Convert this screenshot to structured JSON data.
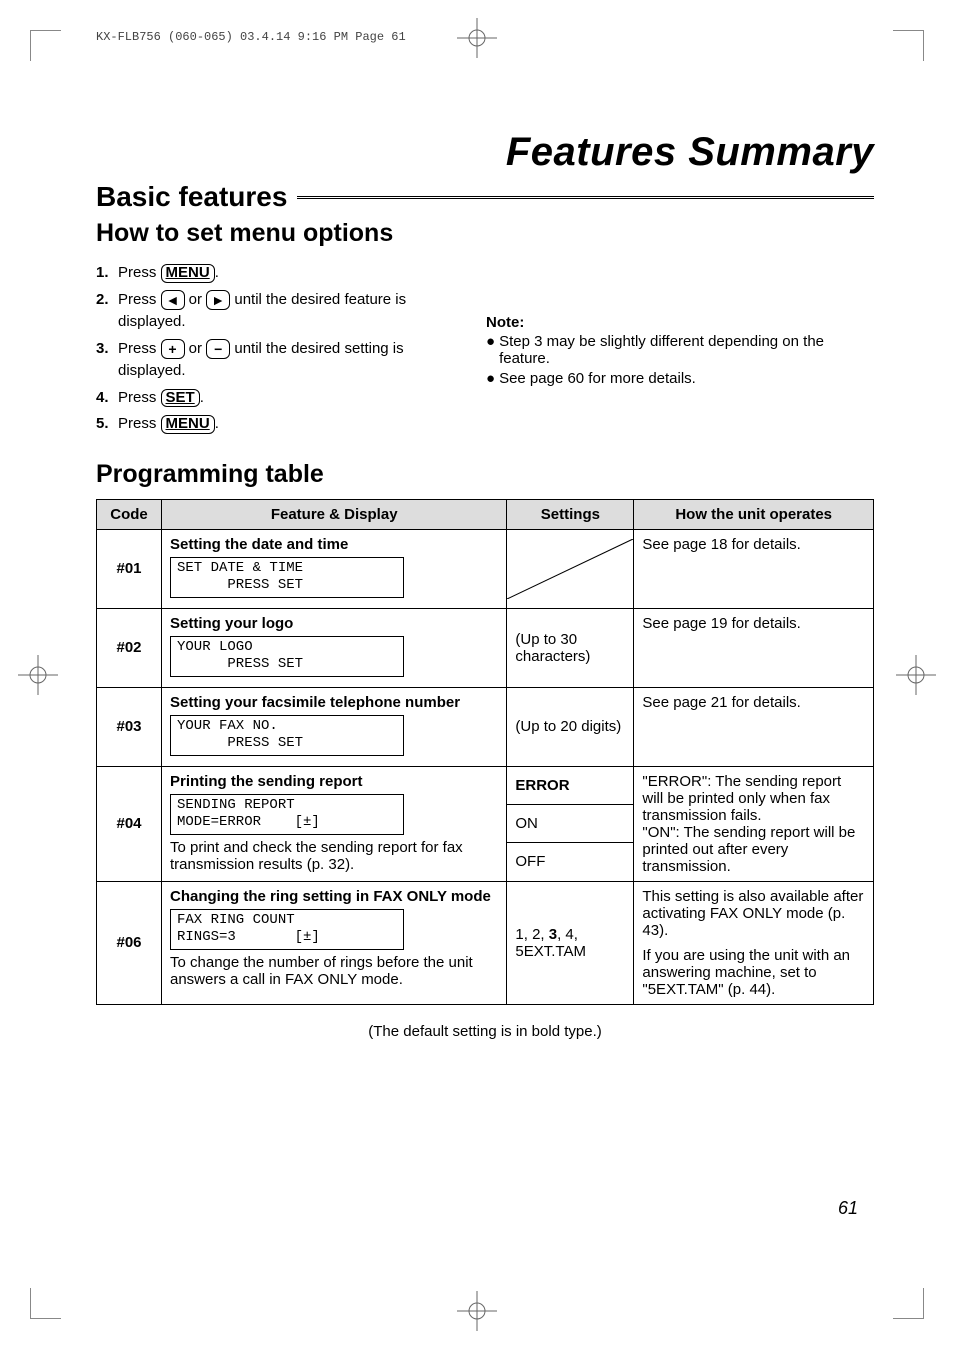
{
  "meta_header": "KX-FLB756 (060-065)  03.4.14  9:16 PM  Page 61",
  "title": "Features Summary",
  "section": "Basic features",
  "sub1": "How to set menu options",
  "steps": {
    "s1a": "Press ",
    "s1_btn": "MENU",
    "s1b": ".",
    "s2a": "Press ",
    "s2b": " or ",
    "s2c": " until the desired feature is displayed.",
    "s3a": "Press ",
    "s3b": " or ",
    "s3c": " until the desired setting is displayed.",
    "s4a": "Press ",
    "s4_btn": "SET",
    "s4b": ".",
    "s5a": "Press ",
    "s5_btn": "MENU",
    "s5b": "."
  },
  "note_head": "Note:",
  "note1": "Step 3 may be slightly different depending on the feature.",
  "note2": "See page 60 for more details.",
  "prog_heading": "Programming table",
  "headers": {
    "code": "Code",
    "feature": "Feature & Display",
    "settings": "Settings",
    "operates": "How the unit operates"
  },
  "rows": {
    "r01": {
      "code": "#01",
      "label": "Setting the date and time",
      "lcd": "SET DATE & TIME\n      PRESS SET",
      "operates": "See page 18 for details."
    },
    "r02": {
      "code": "#02",
      "label": "Setting your logo",
      "lcd": "YOUR LOGO\n      PRESS SET",
      "settings": "(Up to 30 characters)",
      "operates": "See page 19 for details."
    },
    "r03": {
      "code": "#03",
      "label": "Setting your facsimile telephone number",
      "lcd": "YOUR FAX NO.\n      PRESS SET",
      "settings": "(Up to 20 digits)",
      "operates": "See page 21 for details."
    },
    "r04": {
      "code": "#04",
      "label": "Printing the sending report",
      "lcd": "SENDING REPORT\nMODE=ERROR    [±]",
      "desc": "To print and check the sending report for fax transmission results (p. 32).",
      "set1": "ERROR",
      "set2": "ON",
      "set3": "OFF",
      "operates": "\"ERROR\": The sending report will be printed only when fax transmission fails.\n\"ON\": The sending report will be printed out after every transmission."
    },
    "r06": {
      "code": "#06",
      "label": "Changing the ring setting in FAX ONLY mode",
      "lcd": "FAX RING COUNT\nRINGS=3       [±]",
      "desc": "To change the number of rings before the unit answers a call in FAX ONLY mode.",
      "set_pre": "1, 2, ",
      "set_bold": "3",
      "set_post": ", 4, 5EXT.TAM",
      "op1": "This setting is also available after activating FAX ONLY mode (p. 43).",
      "op2": "If you are using the unit with an answering machine, set to \"5EXT.TAM\" (p. 44)."
    }
  },
  "default_note": "(The default setting is in bold type.)",
  "page_num": "61"
}
